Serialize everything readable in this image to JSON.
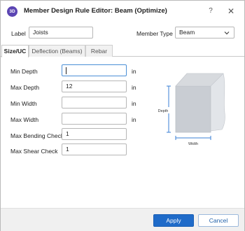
{
  "window": {
    "app_icon_text": "3D",
    "title": "Member Design Rule Editor: Beam (Optimize)",
    "help_glyph": "?",
    "close_glyph": "✕"
  },
  "header": {
    "label_caption": "Label",
    "label_value": "Joists",
    "member_type_caption": "Member Type",
    "member_type_value": "Beam"
  },
  "tabs": [
    {
      "label": "Size/UC",
      "active": true
    },
    {
      "label": "Deflection (Beams)",
      "active": false
    },
    {
      "label": "Rebar",
      "active": false
    }
  ],
  "fields": {
    "min_depth": {
      "label": "Min Depth",
      "value": "",
      "unit": "in"
    },
    "max_depth": {
      "label": "Max Depth",
      "value": "12",
      "unit": "in"
    },
    "min_width": {
      "label": "Min Width",
      "value": "",
      "unit": "in"
    },
    "max_width": {
      "label": "Max Width",
      "value": "",
      "unit": "in"
    },
    "max_bending_check": {
      "label": "Max Bending Check",
      "value": "1"
    },
    "max_shear_check": {
      "label": "Max Shear Check",
      "value": "1"
    }
  },
  "diagram": {
    "depth_label": "Depth",
    "width_label": "Width",
    "dimension_color": "#3a7fd5",
    "face_color": "#c9cdd3",
    "body_color": "#e2e5e9"
  },
  "footer": {
    "apply_label": "Apply",
    "cancel_label": "Cancel"
  }
}
